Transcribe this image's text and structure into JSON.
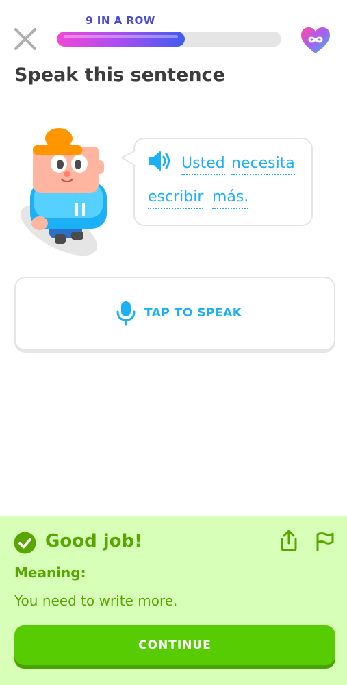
{
  "header": {
    "streak_label": "9 IN A ROW",
    "progress_fraction": 0.57,
    "close_icon": "close-icon",
    "hearts_icon": "infinite-hearts-icon"
  },
  "exercise": {
    "title": "Speak this sentence",
    "sentence_words": [
      "Usted",
      "necesita",
      "escribir",
      "más."
    ],
    "speaker_icon": "speaker-icon",
    "speak_button_label": "TAP TO SPEAK",
    "mic_icon": "microphone-icon"
  },
  "feedback": {
    "heading": "Good job!",
    "meaning_label": "Meaning:",
    "meaning_text": "You need to write more.",
    "continue_label": "CONTINUE",
    "check_icon": "check-icon",
    "share_icon": "share-icon",
    "flag_icon": "flag-icon"
  },
  "colors": {
    "accent_blue": "#1cb0f6",
    "success_green": "#58a700",
    "button_green": "#58cc02",
    "feedback_bg": "#d7ffb8",
    "streak_purple": "#4b4bd8"
  }
}
